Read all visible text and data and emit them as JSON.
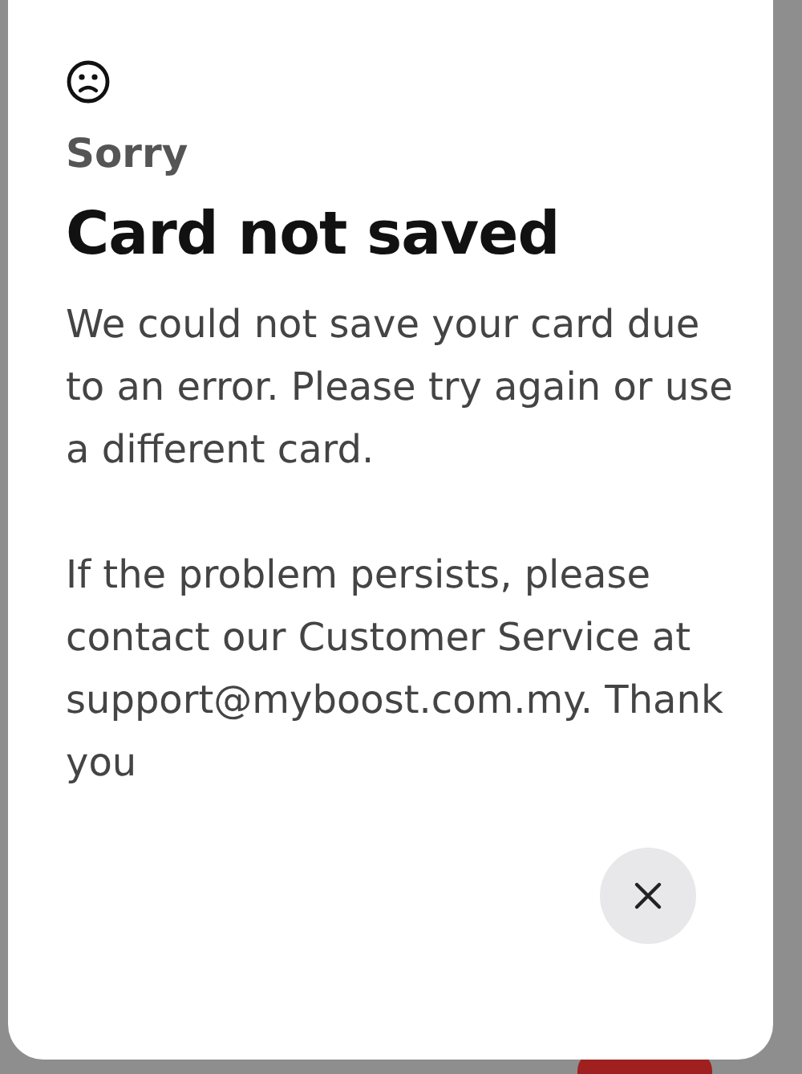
{
  "dialog": {
    "eyebrow": "Sorry",
    "title": "Card not saved",
    "paragraphs": [
      "We could not save your card due to an error. Please try again or use a different card.",
      "If the problem persists, please contact our Customer Service at support@myboost.com.my. Thank you"
    ]
  }
}
